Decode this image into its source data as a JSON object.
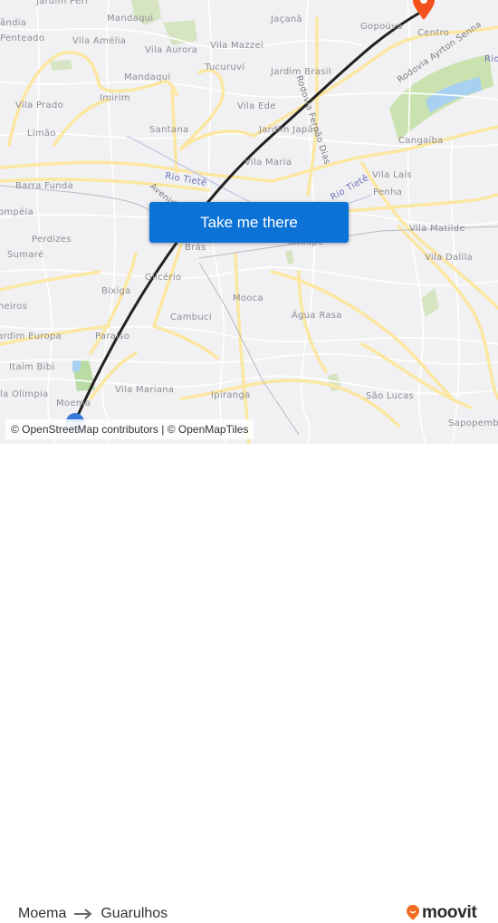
{
  "map": {
    "labels": [
      {
        "text": "Jardim Peri",
        "kind": "place"
      },
      {
        "text": "ândia",
        "kind": "place"
      },
      {
        "text": "Penteado",
        "kind": "place"
      },
      {
        "text": "Mandaqui",
        "kind": "place"
      },
      {
        "text": "Vila Amélia",
        "kind": "place"
      },
      {
        "text": "Vila Aurora",
        "kind": "place"
      },
      {
        "text": "Vila Mazzei",
        "kind": "place"
      },
      {
        "text": "Tucuruvi",
        "kind": "place"
      },
      {
        "text": "Mandaqui",
        "kind": "place"
      },
      {
        "text": "Imirim",
        "kind": "place"
      },
      {
        "text": "Vila Prado",
        "kind": "place"
      },
      {
        "text": "Limão",
        "kind": "place"
      },
      {
        "text": "Santana",
        "kind": "place"
      },
      {
        "text": "Jaçanã",
        "kind": "place"
      },
      {
        "text": "Gopoúva",
        "kind": "place"
      },
      {
        "text": "Centro",
        "kind": "place"
      },
      {
        "text": "Jardim Brasil",
        "kind": "place"
      },
      {
        "text": "Vila Ede",
        "kind": "place"
      },
      {
        "text": "Jardim Japão",
        "kind": "place"
      },
      {
        "text": "Vila Maria",
        "kind": "place"
      },
      {
        "text": "Cangaíba",
        "kind": "place"
      },
      {
        "text": "Vila Laís",
        "kind": "place"
      },
      {
        "text": "Penha",
        "kind": "place"
      },
      {
        "text": "Vila Matilde",
        "kind": "place"
      },
      {
        "text": "Vila Dalila",
        "kind": "place"
      },
      {
        "text": "Barra Funda",
        "kind": "place"
      },
      {
        "text": "Pompéia",
        "kind": "place"
      },
      {
        "text": "Perdizes",
        "kind": "place"
      },
      {
        "text": "Sumaré",
        "kind": "place"
      },
      {
        "text": "Brás",
        "kind": "place"
      },
      {
        "text": "Glicério",
        "kind": "place"
      },
      {
        "text": "Bixiga",
        "kind": "place"
      },
      {
        "text": "Tatuapé",
        "kind": "place"
      },
      {
        "text": "Mooca",
        "kind": "place"
      },
      {
        "text": "Água Rasa",
        "kind": "place"
      },
      {
        "text": "Pinheiros",
        "kind": "place"
      },
      {
        "text": "Cambuci",
        "kind": "place"
      },
      {
        "text": "Jardim Europa",
        "kind": "place"
      },
      {
        "text": "Paraíso",
        "kind": "place"
      },
      {
        "text": "Itaim Bibi",
        "kind": "place"
      },
      {
        "text": "Vila Olímpia",
        "kind": "place"
      },
      {
        "text": "Vila Mariana",
        "kind": "place"
      },
      {
        "text": "Moema",
        "kind": "place"
      },
      {
        "text": "Ipiranga",
        "kind": "place"
      },
      {
        "text": "São Lucas",
        "kind": "place"
      },
      {
        "text": "Sapopemba",
        "kind": "place"
      },
      {
        "text": "Rio Tietê",
        "kind": "water"
      },
      {
        "text": "Rio Tietê",
        "kind": "water"
      },
      {
        "text": "Rio",
        "kind": "water"
      },
      {
        "text": "Avenida",
        "kind": "road"
      },
      {
        "text": "Rodovia Fernão Dias",
        "kind": "road"
      },
      {
        "text": "Rodovia Ayrton Senna",
        "kind": "road"
      }
    ],
    "origin_marker": "origin-dot-icon",
    "destination_marker": "destination-pin-icon",
    "colors": {
      "background": "#f1f1f3",
      "major_road": "#fbe7a1",
      "park": "#cfe0b4",
      "water": "#a8d0f0",
      "route_line": "#222222",
      "origin": "#4a86e8",
      "destination": "#f4511e"
    }
  },
  "cta": {
    "label": "Take me there",
    "color": "#0d72d6"
  },
  "attribution": "© OpenStreetMap contributors | © OpenMapTiles",
  "footer": {
    "origin": "Moema",
    "arrow_icon": "arrow-right-icon",
    "destination": "Guarulhos",
    "brand": "moovit",
    "brand_color": "#f26b21"
  }
}
